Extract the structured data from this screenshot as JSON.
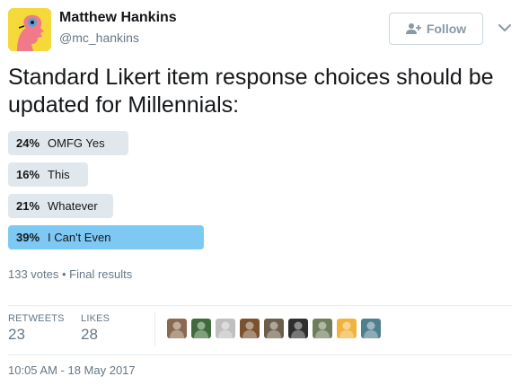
{
  "author": {
    "name": "Matthew Hankins",
    "handle": "@mc_hankins",
    "avatar_icon": "cartoon-face-avatar-icon"
  },
  "follow_button": {
    "label": "Follow",
    "icon": "add-user-icon"
  },
  "menu_icon": "chevron-down-icon",
  "tweet_text": "Standard Likert item response choices should be updated for Millennials:",
  "poll": {
    "choices": [
      {
        "percent": "24%",
        "label": "OMFG Yes",
        "value": 24,
        "winner": false
      },
      {
        "percent": "16%",
        "label": "This",
        "value": 16,
        "winner": false
      },
      {
        "percent": "21%",
        "label": "Whatever",
        "value": 21,
        "winner": false
      },
      {
        "percent": "39%",
        "label": "I Can't Even",
        "value": 39,
        "winner": true
      }
    ],
    "summary": "133 votes • Final results"
  },
  "stats": {
    "retweets_label": "RETWEETS",
    "retweets_count": "23",
    "likes_label": "LIKES",
    "likes_count": "28"
  },
  "likers": [
    {
      "name": "liker-avatar-1",
      "color": "#8a6a4f"
    },
    {
      "name": "liker-avatar-2",
      "color": "#3f6b3a"
    },
    {
      "name": "liker-avatar-3",
      "color": "#bfbfbf"
    },
    {
      "name": "liker-avatar-4",
      "color": "#7a5230"
    },
    {
      "name": "liker-avatar-5",
      "color": "#6b5e4a"
    },
    {
      "name": "liker-avatar-6",
      "color": "#2f2f2f"
    },
    {
      "name": "liker-avatar-7",
      "color": "#6f7d5a"
    },
    {
      "name": "liker-avatar-8",
      "color": "#f2b33d"
    },
    {
      "name": "liker-avatar-9",
      "color": "#4f7f8f"
    }
  ],
  "timestamp": "10:05 AM - 18 May 2017",
  "colors": {
    "winner_bar": "#7ec8f4",
    "bar": "#e1e8ed",
    "muted_text": "#657786"
  }
}
